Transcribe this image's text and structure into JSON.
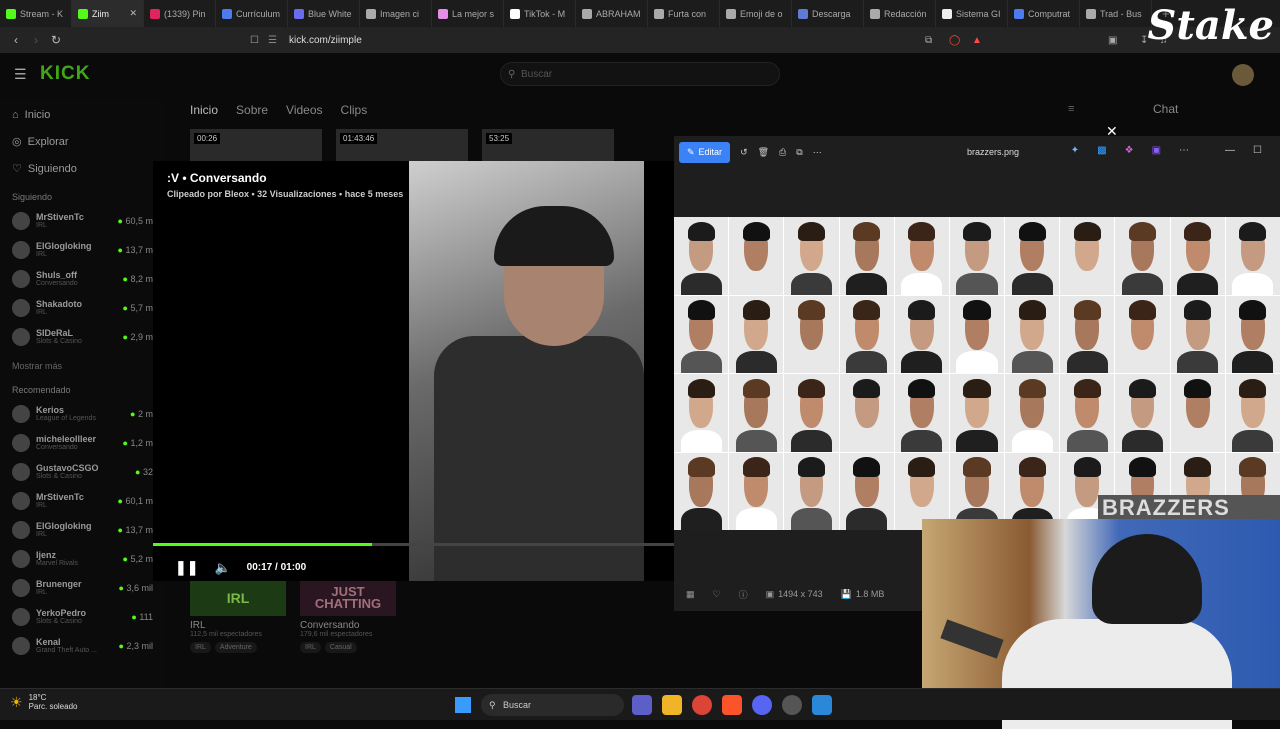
{
  "browser": {
    "tabs": [
      {
        "label": "Stream - K",
        "color": "#53fc18",
        "active": false
      },
      {
        "label": "Ziim",
        "color": "#53fc18",
        "active": true
      },
      {
        "label": "(1339) Pin",
        "color": "#e0245e",
        "active": false
      },
      {
        "label": "Currículum",
        "color": "#4f7bf0",
        "active": false
      },
      {
        "label": "Blue White",
        "color": "#6b6bf0",
        "active": false
      },
      {
        "label": "Imagen ci",
        "color": "#aaaaaa",
        "active": false
      },
      {
        "label": "La mejor s",
        "color": "#e58ee8",
        "active": false
      },
      {
        "label": "TikTok - M",
        "color": "#ffffff",
        "active": false
      },
      {
        "label": "ABRAHAM",
        "color": "#aaaaaa",
        "active": false
      },
      {
        "label": "Furta con",
        "color": "#aaaaaa",
        "active": false
      },
      {
        "label": "Emoji de o",
        "color": "#aaaaaa",
        "active": false
      },
      {
        "label": "Descarga",
        "color": "#5f7bd5",
        "active": false
      },
      {
        "label": "Redacción",
        "color": "#aaaaaa",
        "active": false
      },
      {
        "label": "Sistema GI",
        "color": "#eeeeee",
        "active": false
      },
      {
        "label": "Computrat",
        "color": "#4f7bf0",
        "active": false
      },
      {
        "label": "Trad - Bus",
        "color": "#aaaaaa",
        "active": false
      }
    ],
    "new_tab": "+",
    "url": "kick.com/ziimple",
    "overlay_brand": "Stake"
  },
  "kick": {
    "logo": "KICK",
    "search_placeholder": "Buscar",
    "nav": [
      {
        "label": "Inicio",
        "icon": "home-icon"
      },
      {
        "label": "Explorar",
        "icon": "compass-icon"
      },
      {
        "label": "Siguiendo",
        "icon": "heart-icon"
      }
    ],
    "following_title": "Siguiendo",
    "following": [
      {
        "name": "MrStivenTc",
        "cat": "IRL",
        "viewers": "60,5 m"
      },
      {
        "name": "ElGlogloking",
        "cat": "IRL",
        "viewers": "13,7 m"
      },
      {
        "name": "Shuls_off",
        "cat": "Conversando",
        "viewers": "8,2 m"
      },
      {
        "name": "Shakadoto",
        "cat": "IRL",
        "viewers": "5,7 m"
      },
      {
        "name": "SIDeRaL",
        "cat": "Slots & Casino",
        "viewers": "2,9 m"
      }
    ],
    "show_more": "Mostrar más",
    "recommended_title": "Recomendado",
    "recommended": [
      {
        "name": "Kerios",
        "cat": "League of Legends",
        "viewers": "2 m"
      },
      {
        "name": "micheleollleer",
        "cat": "Conversando",
        "viewers": "1,2 m"
      },
      {
        "name": "GustavoCSGO",
        "cat": "Slots & Casino",
        "viewers": "32"
      },
      {
        "name": "MrStivenTc",
        "cat": "IRL",
        "viewers": "60,1 m"
      },
      {
        "name": "ElGlogloking",
        "cat": "IRL",
        "viewers": "13,7 m"
      },
      {
        "name": "Ijenz",
        "cat": "Marvel Rivals",
        "viewers": "5,2 m"
      },
      {
        "name": "Brunenger",
        "cat": "IRL",
        "viewers": "3,6 mil"
      },
      {
        "name": "YerkoPedro",
        "cat": "Slots & Casino",
        "viewers": "111"
      },
      {
        "name": "Kenal",
        "cat": "Grand Theft Auto ...",
        "viewers": "2,3 mil"
      }
    ],
    "channel_tabs": [
      "Inicio",
      "Sobre",
      "Videos",
      "Clips"
    ],
    "chat_label": "Chat",
    "thumb_times": [
      "00:26",
      "01:43:46",
      "53:25"
    ],
    "categories": [
      {
        "art": "IRL",
        "title": "IRL",
        "viewers": "112,5 mil espectadores",
        "tags": [
          "IRL",
          "Adventure"
        ]
      },
      {
        "art": "JUST CHATTING",
        "title": "Conversando",
        "viewers": "179,6 mil espectadores",
        "tags": [
          "IRL",
          "Casual"
        ]
      }
    ]
  },
  "clip": {
    "title": ":V • Conversando",
    "subtitle": "Clipeado por Bleox • 32 Visualizaciones • hace 5 meses",
    "time": "00:17 / 01:00",
    "progress": 0.42
  },
  "viewer": {
    "edit_label": "Editar",
    "filename": "brazzers.png",
    "dimensions": "1494 x 743",
    "filesize": "1.8 MB",
    "watermark": "BRAZZERS"
  },
  "taskbar": {
    "temp": "18°C",
    "weather": "Parc. soleado",
    "search": "Buscar"
  }
}
